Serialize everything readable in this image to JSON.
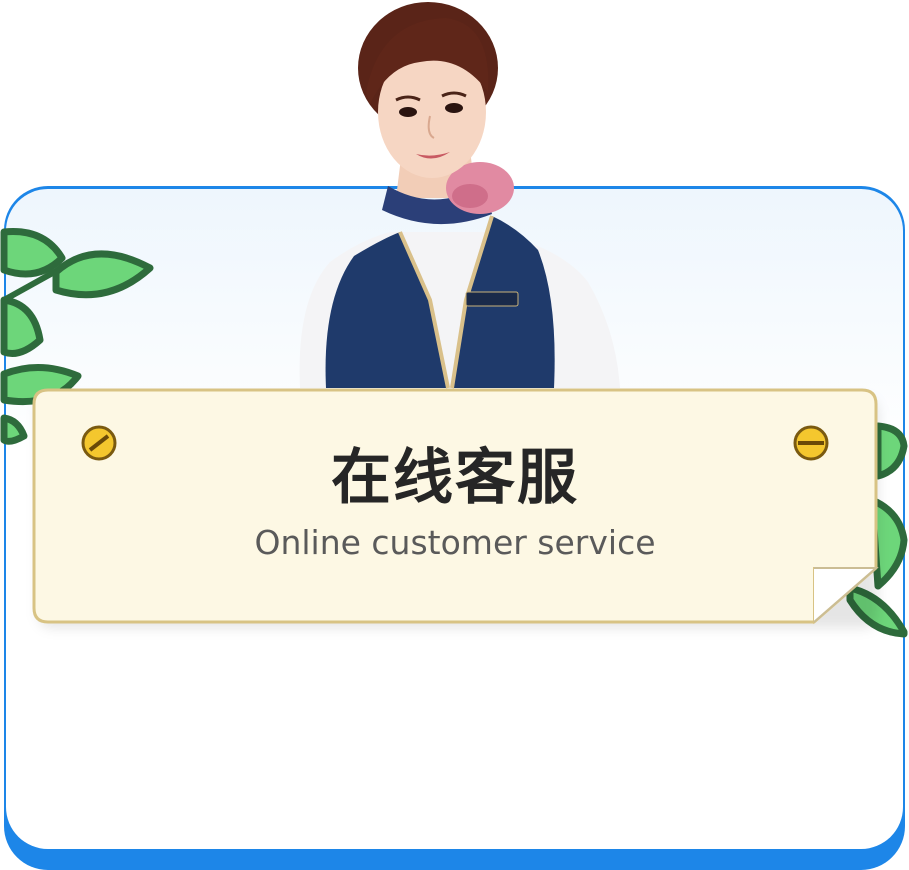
{
  "card": {
    "title": "在线客服",
    "subtitle": "Online customer service"
  },
  "icons": {
    "left_screw": "screw-icon",
    "right_screw": "screw-icon",
    "leaves": "leaf-vine-icon",
    "agent": "customer-service-agent-photo"
  },
  "colors": {
    "accent_blue": "#1d86e8",
    "board_fill": "#fdf8e4",
    "board_border": "#d8c384",
    "leaf_green": "#6dd67a",
    "leaf_outline": "#2e6b3c",
    "screw_gold": "#e8b400",
    "title_text": "#262626",
    "subtitle_text": "#5a5a5a"
  }
}
